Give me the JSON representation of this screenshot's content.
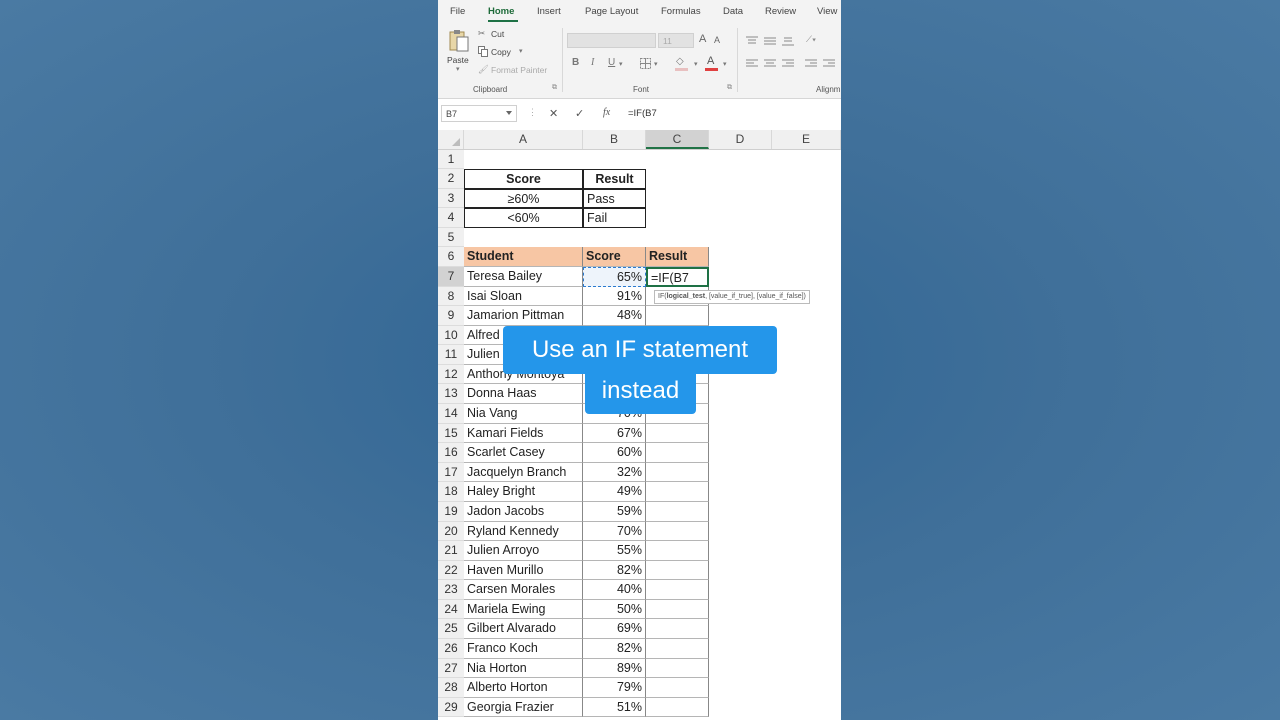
{
  "ribbon": {
    "tabs": [
      "File",
      "Home",
      "Insert",
      "Page Layout",
      "Formulas",
      "Data",
      "Review",
      "View"
    ],
    "clipboard": {
      "paste": "Paste",
      "cut": "Cut",
      "copy": "Copy",
      "format_painter": "Format Painter",
      "label": "Clipboard"
    },
    "font": {
      "size": "11",
      "bold": "B",
      "italic": "I",
      "underline": "U",
      "grow": "A",
      "shrink": "A",
      "font_color": "A",
      "label": "Font"
    },
    "alignment": {
      "label": "Alignm"
    }
  },
  "formula_bar": {
    "name_box": "B7",
    "cancel": "✕",
    "enter": "✓",
    "fx": "fx",
    "formula": "=IF(B7"
  },
  "columns": [
    "A",
    "B",
    "C",
    "D",
    "E"
  ],
  "rows": [
    "1",
    "2",
    "3",
    "4",
    "5",
    "6",
    "7",
    "8",
    "9",
    "10",
    "11",
    "12",
    "13",
    "14",
    "15",
    "16",
    "17",
    "18",
    "19",
    "20",
    "21",
    "22",
    "23",
    "24",
    "25",
    "26",
    "27",
    "28",
    "29"
  ],
  "criteria_table": {
    "headers": [
      "Score",
      "Result"
    ],
    "rows": [
      [
        "≥60%",
        "Pass"
      ],
      [
        "<60%",
        "Fail"
      ]
    ]
  },
  "student_table": {
    "headers": [
      "Student",
      "Score",
      "Result"
    ],
    "rows": [
      [
        "Teresa Bailey",
        "65%",
        "=IF(B7"
      ],
      [
        "Isai Sloan",
        "91%",
        ""
      ],
      [
        "Jamarion Pittman",
        "48%",
        ""
      ],
      [
        "Alfred",
        "",
        ""
      ],
      [
        "Julien",
        "",
        ""
      ],
      [
        "Anthony Montoya",
        "",
        ""
      ],
      [
        "Donna Haas",
        "",
        ""
      ],
      [
        "Nia Vang",
        "70%",
        ""
      ],
      [
        "Kamari Fields",
        "67%",
        ""
      ],
      [
        "Scarlet Casey",
        "60%",
        ""
      ],
      [
        "Jacquelyn Branch",
        "32%",
        ""
      ],
      [
        "Haley Bright",
        "49%",
        ""
      ],
      [
        "Jadon Jacobs",
        "59%",
        ""
      ],
      [
        "Ryland Kennedy",
        "70%",
        ""
      ],
      [
        "Julien Arroyo",
        "55%",
        ""
      ],
      [
        "Haven Murillo",
        "82%",
        ""
      ],
      [
        "Carsen Morales",
        "40%",
        ""
      ],
      [
        "Mariela Ewing",
        "50%",
        ""
      ],
      [
        "Gilbert Alvarado",
        "69%",
        ""
      ],
      [
        "Franco Koch",
        "82%",
        ""
      ],
      [
        "Nia Horton",
        "89%",
        ""
      ],
      [
        "Alberto Horton",
        "79%",
        ""
      ],
      [
        "Georgia Frazier",
        "51%",
        ""
      ]
    ]
  },
  "function_hint": {
    "fn": "IF(",
    "arg1": "logical_test",
    "rest": ", [value_if_true], [value_if_false])"
  },
  "caption": {
    "line1": "Use an IF statement",
    "line2": "instead"
  },
  "colors": {
    "accent_green": "#217346",
    "header_fill": "#f7c6a4",
    "caption_bg": "#2496ea",
    "background": "#3f6f99"
  },
  "icons": [
    "scissors-icon",
    "copy-icon",
    "paste-icon",
    "format-painter-icon",
    "borders-icon",
    "fill-color-icon",
    "align-left-icon",
    "align-center-icon",
    "align-right-icon",
    "indent-icon",
    "orientation-icon",
    "dialog-launcher-icon"
  ]
}
